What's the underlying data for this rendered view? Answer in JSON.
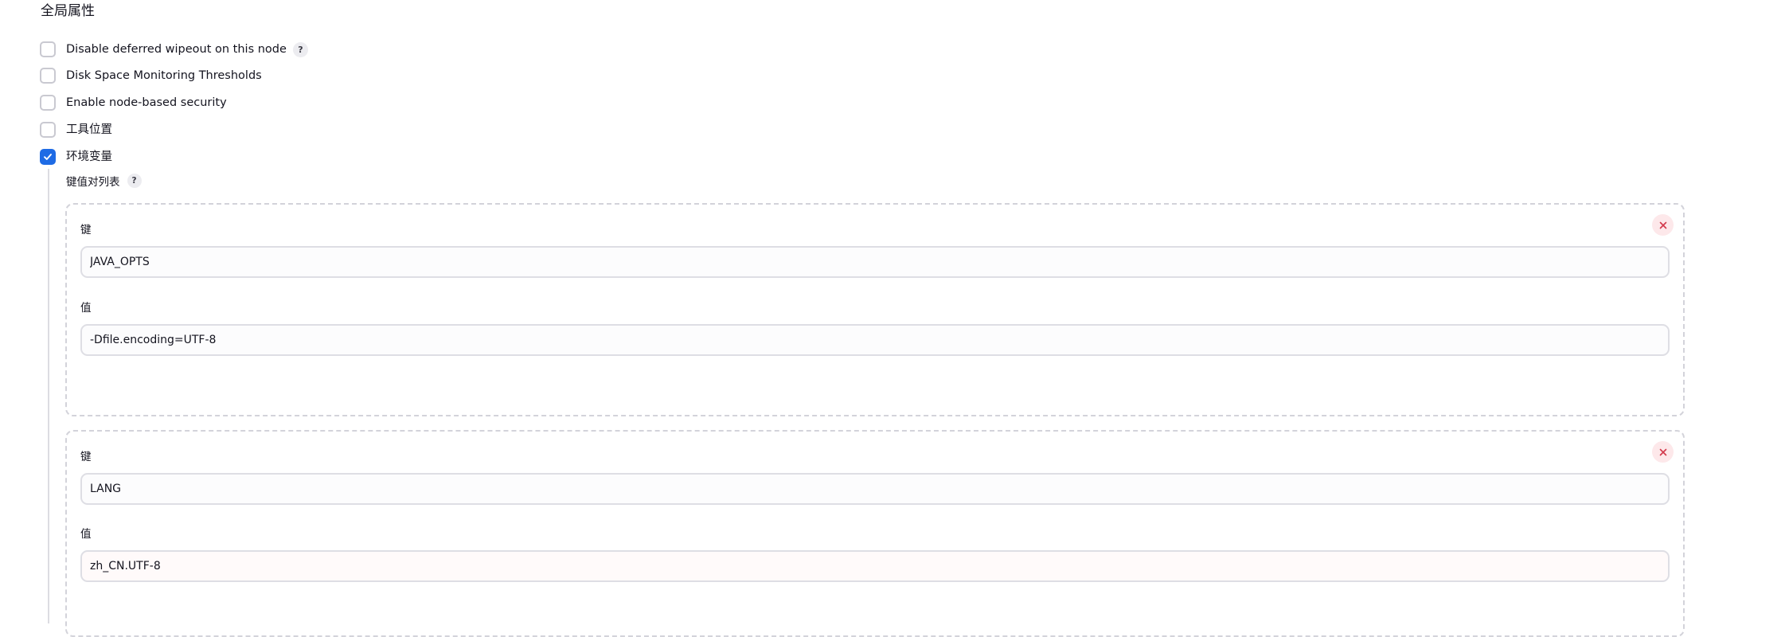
{
  "section": {
    "title": "全局属性"
  },
  "options": [
    {
      "label": "Disable deferred wipeout on this node",
      "checked": false,
      "has_help": true
    },
    {
      "label": "Disk Space Monitoring Thresholds",
      "checked": false,
      "has_help": false
    },
    {
      "label": "Enable node-based security",
      "checked": false,
      "has_help": false
    },
    {
      "label": "工具位置",
      "checked": false,
      "has_help": false
    },
    {
      "label": "环境变量",
      "checked": true,
      "has_help": false
    }
  ],
  "env_vars": {
    "list_label": "键值对列表",
    "help_glyph": "?",
    "key_label": "键",
    "value_label": "值",
    "entries": [
      {
        "key": "JAVA_OPTS",
        "value": "-Dfile.encoding=UTF-8"
      },
      {
        "key": "LANG",
        "value": "zh_CN.UTF-8"
      }
    ]
  },
  "colors": {
    "accent": "#1e6be5",
    "delete_bg": "#fde8ea",
    "delete_x": "#d2394b",
    "border": "#d3d3da"
  },
  "icons": {
    "checkbox_checked": "check-icon",
    "delete": "close-icon",
    "help": "help-icon"
  }
}
